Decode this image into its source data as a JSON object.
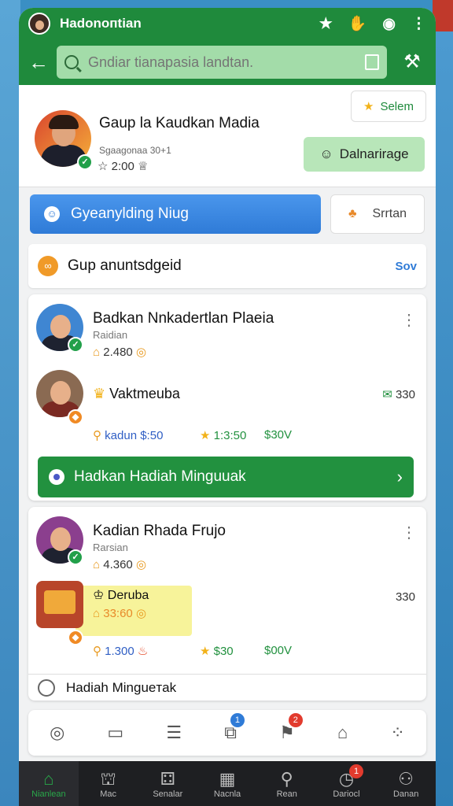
{
  "status_bar": {
    "title": "Hadonoпtian"
  },
  "toolbar": {
    "search_placeholder": "Gndiar tianapasia landtan."
  },
  "profile": {
    "name": "Gaup la Kaudkan Madia",
    "subtitle": "Sgaagonaa 30+1",
    "stat": "2:00",
    "button1_label": "Selem",
    "button2_label": "Dalnarirage"
  },
  "actions": {
    "primary_label": "Gyeanylding Niug",
    "secondary_label": "Srrtan"
  },
  "group_row": {
    "title": "Gup anuntsdgeid",
    "link": "Sov"
  },
  "card1": {
    "name": "Badkan Nnkadertlan Plaeia",
    "subtitle": "Raidian",
    "stat": "2.480",
    "item_name": "Vaktmeuba",
    "item_count": "330",
    "price_label": "kadun",
    "price_value": "$:50",
    "rating_value": "1:3:50",
    "price2": "$30V",
    "action_label": "Hadkan Hadiah Minguuak"
  },
  "card2": {
    "name": "Kadian Rhada Frujo",
    "subtitle": "Rarsian",
    "stat": "4.360",
    "item_name": "Deruba",
    "item_stat": "33:60",
    "item_count": "330",
    "price_value": "1.300",
    "rating_value": "$30",
    "price2": "$00V",
    "footer_label": "Hadiah Mingueтak"
  },
  "icon_bar": {
    "badge1": "1",
    "badge2": "2"
  },
  "bottom_nav": [
    {
      "label": "Nianlean",
      "icon": "home-icon"
    },
    {
      "label": "Mac",
      "icon": "shop-icon"
    },
    {
      "label": "Senalar",
      "icon": "grid-icon"
    },
    {
      "label": "Nacnla",
      "icon": "calendar-icon"
    },
    {
      "label": "Rean",
      "icon": "search-icon"
    },
    {
      "label": "Dariocl",
      "icon": "clock-icon",
      "badge": "1"
    },
    {
      "label": "Danan",
      "icon": "profile-icon"
    }
  ]
}
